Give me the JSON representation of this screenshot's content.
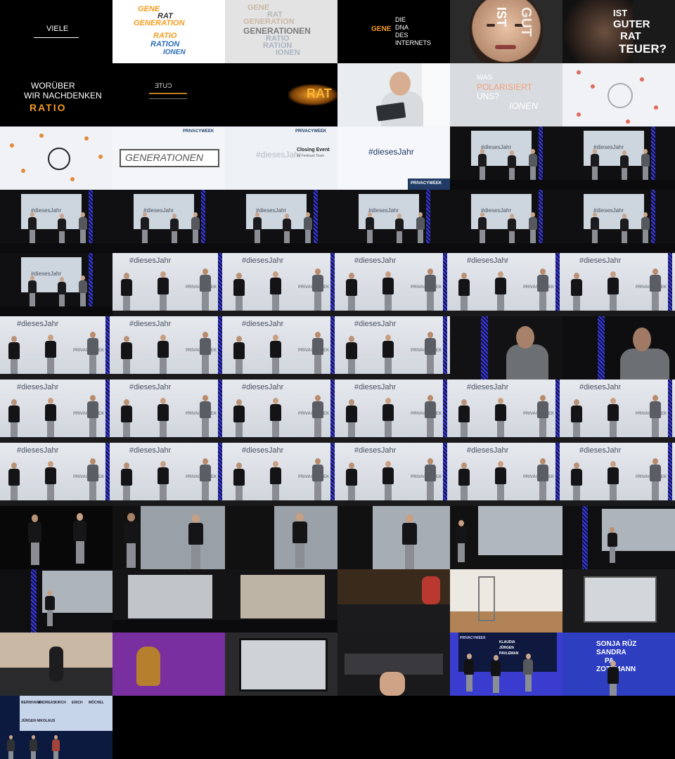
{
  "slides": {
    "viele": "VIELE",
    "gene_cloud": [
      "GENE",
      "RAT",
      "GENERATION",
      "RATIO",
      "RATION",
      "IONEN"
    ],
    "gene_cloud_faded": [
      "GENE",
      "RAT",
      "GENERATION",
      "GENERATIONEN",
      "RATIO",
      "RATION",
      "IONEN"
    ],
    "dna": [
      "GENE",
      "DIE",
      "DNA",
      "DES",
      "INTERNETS"
    ],
    "ist_gut": [
      "IST",
      "GUT"
    ],
    "ist_guter_rat_teuer": [
      "IST",
      "GUTER",
      "RAT",
      "TEUER?"
    ],
    "woruber": [
      "WORÜBER",
      "WIR NACHDENKEN",
      "RATIO"
    ],
    "mirror": "ƎTUƆ",
    "rat_flare": "RAT",
    "polarisiert": [
      "WAS",
      "POLARISIERT",
      "UNS?",
      "IONEN"
    ],
    "generationen_box": "GENERATIONEN",
    "privacyweek": "PRIVACYWEEK",
    "hashtag": "#diesesJahr",
    "closing_event": "Closing Event",
    "closing_event_sub": "im Festsaal Team",
    "sponsor_names_1": [
      "KLAUDIA",
      "JÜRGEN",
      "PAVLEMAN"
    ],
    "sponsor_names_2": [
      "SONJA RÜZ",
      "SANDRA",
      "PA",
      "ZOTZMANN"
    ],
    "credits": [
      "BERNHARD",
      "ANDREAS",
      "KIRCH",
      "ERICH",
      "MÖCHEL",
      "JÜRGEN NIKOLAUS"
    ],
    "laptop_label": "PRIVACYWEEK"
  },
  "colors": {
    "accent_orange": "#f39c1f",
    "accent_blue": "#2d6fb5",
    "accent_salmon": "#f4a07a",
    "truss_blue": "#3a3bd8",
    "screen": "#dfe4ea"
  }
}
